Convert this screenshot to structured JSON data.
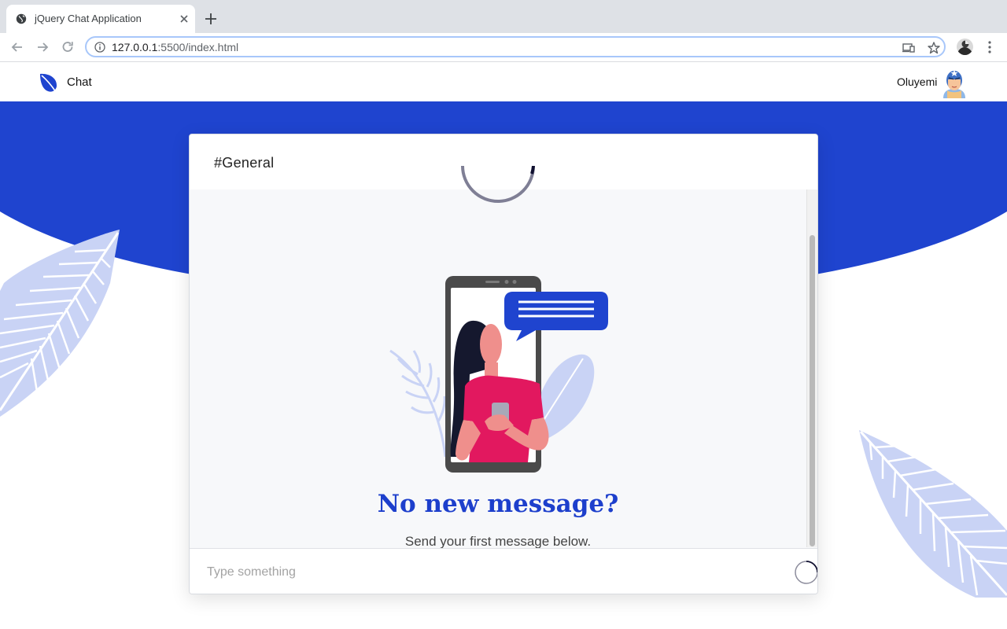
{
  "browser": {
    "tab_title": "jQuery Chat Application",
    "url_host": "127.0.0.1",
    "url_rest": ":5500/index.html"
  },
  "app": {
    "brand": "Chat",
    "user_name": "Oluyemi",
    "channel": "#General",
    "empty_title": "No new message?",
    "empty_subtitle": "Send your first message below.",
    "composer_placeholder": "Type something"
  },
  "colors": {
    "brand_blue": "#1f44cf",
    "leaf_light": "#c9d3f5",
    "shirt_pink": "#e2185f"
  }
}
